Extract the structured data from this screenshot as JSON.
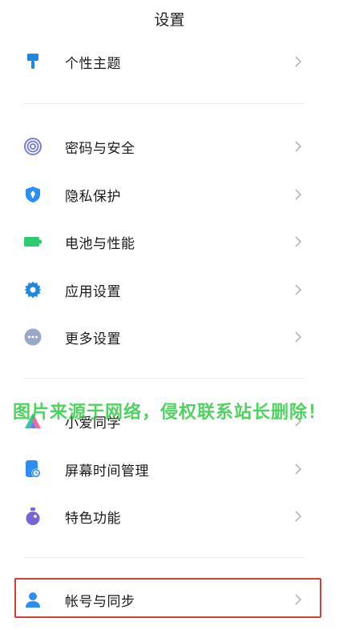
{
  "header": {
    "title": "设置"
  },
  "groups": [
    {
      "items": [
        {
          "label": "个性主题",
          "icon": "paintbrush-icon",
          "color": "#1e88e5"
        }
      ]
    },
    {
      "items": [
        {
          "label": "密码与安全",
          "icon": "fingerprint-icon",
          "color": "#7b7fd8"
        },
        {
          "label": "隐私保护",
          "icon": "shield-icon",
          "color": "#2b8ef0"
        },
        {
          "label": "电池与性能",
          "icon": "battery-icon",
          "color": "#2ecc71"
        },
        {
          "label": "应用设置",
          "icon": "gear-icon",
          "color": "#1e88e5"
        },
        {
          "label": "更多设置",
          "icon": "more-dots-icon",
          "color": "#9aa8c8"
        }
      ]
    },
    {
      "items": [
        {
          "label": "小爱同学",
          "icon": "xiaoai-icon",
          "color": "#3ec3a0"
        },
        {
          "label": "屏幕时间管理",
          "icon": "screen-time-icon",
          "color": "#2b8ef0"
        },
        {
          "label": "特色功能",
          "icon": "flask-icon",
          "color": "#7b63d8"
        }
      ]
    },
    {
      "items": [
        {
          "label": "帐号与同步",
          "icon": "account-icon",
          "color": "#2b8ef0"
        }
      ]
    }
  ],
  "watermark": "图片来源于网络，侵权联系站长删除！",
  "colors": {
    "highlight_border": "#d93a3a",
    "chevron": "#b5b5b5",
    "divider": "#ececec"
  }
}
